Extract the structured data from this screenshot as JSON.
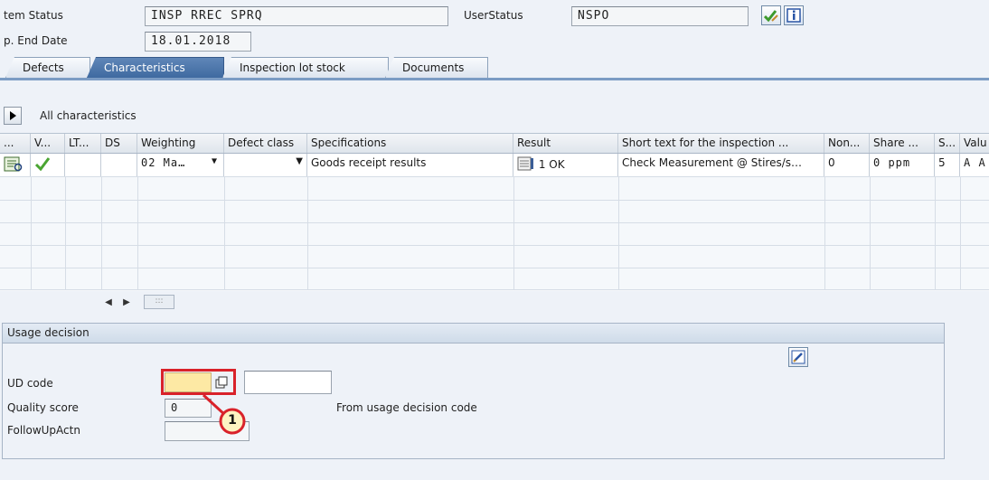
{
  "header": {
    "item_status_label": "tem Status",
    "item_status_value": "INSP RREC SPRQ",
    "user_status_label": "UserStatus",
    "user_status_value": "NSPO",
    "end_date_label": "p. End Date",
    "end_date_value": "18.01.2018"
  },
  "tabs": [
    {
      "label": "Defects"
    },
    {
      "label": "Characteristics",
      "active": true
    },
    {
      "label": "Inspection lot stock"
    },
    {
      "label": "Documents"
    }
  ],
  "toolbar": {
    "all_characteristics_label": "All characteristics"
  },
  "table": {
    "headers": [
      "...",
      "V...",
      "LT...",
      "DS",
      "Weighting",
      "Defect class",
      "Specifications",
      "Result",
      "Short text for the inspection ...",
      "Non...",
      "Share ...",
      "S...",
      "Valu"
    ],
    "row": {
      "weighting": "02 Ma…",
      "specifications": "Goods receipt results",
      "result": "1 OK",
      "short_text": "Check Measurement @ Stires/s…",
      "non": "0",
      "share": "0 ppm",
      "s": "5",
      "value": "A A"
    },
    "scroll_thumb": ":::"
  },
  "usage_decision": {
    "title": "Usage decision",
    "ud_code_label": "UD code",
    "ud_code_value": "",
    "quality_score_label": "Quality score",
    "quality_score_value": "0",
    "from_code_text": "From usage decision code",
    "followup_label": "FollowUpActn",
    "followup_value": ""
  },
  "callout": {
    "number": "1",
    "color": "#d9222a"
  },
  "colors": {
    "active_tab": "#4a76ad",
    "accent_line": "#7b9cc4",
    "highlight": "#d9222a",
    "ud_field": "#fde9a4"
  },
  "icons": [
    "check-pencil-icon",
    "info-icon",
    "play-icon",
    "detail-icon",
    "checkmark-icon",
    "dropdown-arrow-icon",
    "result-list-icon",
    "copy-icon",
    "edit-icon"
  ]
}
